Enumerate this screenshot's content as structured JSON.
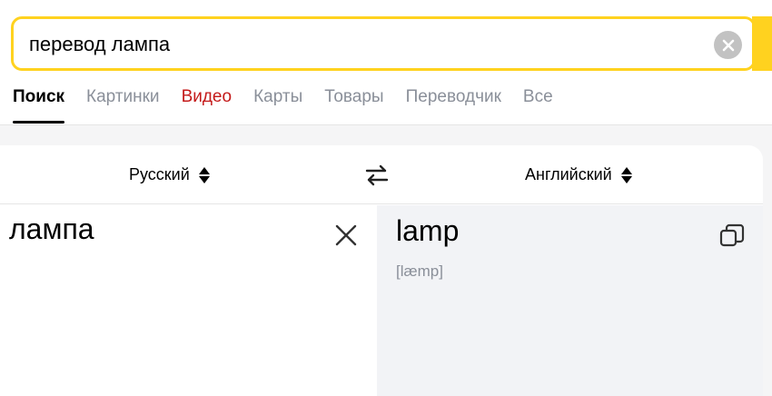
{
  "search": {
    "query": "перевод лампа",
    "clear_icon": "close-circle-icon",
    "accent_color": "#ffd21f"
  },
  "nav": {
    "tabs": [
      {
        "label": "Поиск",
        "active": true
      },
      {
        "label": "Картинки"
      },
      {
        "label": "Видео",
        "color": "#c41a1a"
      },
      {
        "label": "Карты"
      },
      {
        "label": "Товары"
      },
      {
        "label": "Переводчик"
      },
      {
        "label": "Все"
      }
    ]
  },
  "translator": {
    "source_lang": "Русский",
    "target_lang": "Английский",
    "swap_icon": "swap-arrows-icon",
    "source_text": "лампа",
    "source_clear_icon": "close-icon",
    "target_text": "lamp",
    "transcription": "[læmp]",
    "copy_icon": "copy-icon",
    "target_bg": "#f2f3f6"
  }
}
